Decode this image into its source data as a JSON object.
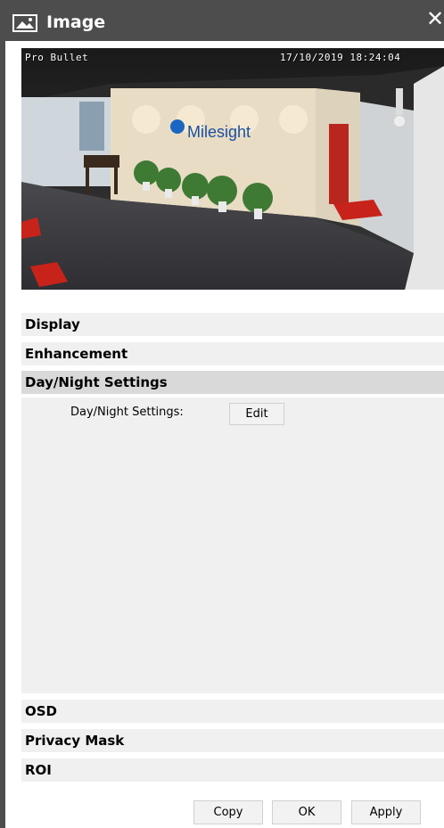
{
  "window": {
    "title": "Image",
    "title_icon": "image-icon",
    "close_label": "✕"
  },
  "preview": {
    "osd_left": "Pro Bullet",
    "osd_right": "17/10/2019 18:24:04",
    "logo_text": "Milesight"
  },
  "sections": {
    "display": "Display",
    "enhancement": "Enhancement",
    "day_night": "Day/Night Settings",
    "osd": "OSD",
    "privacy_mask": "Privacy Mask",
    "roi": "ROI"
  },
  "day_night_panel": {
    "label": "Day/Night Settings:",
    "edit_button": "Edit"
  },
  "footer": {
    "copy_button": "Copy",
    "ok_button": "OK",
    "apply_button": "Apply"
  },
  "colors": {
    "titlebar": "#4d4d4d",
    "section_bg": "#f0f0f0",
    "section_active_bg": "#d9d9d9"
  }
}
